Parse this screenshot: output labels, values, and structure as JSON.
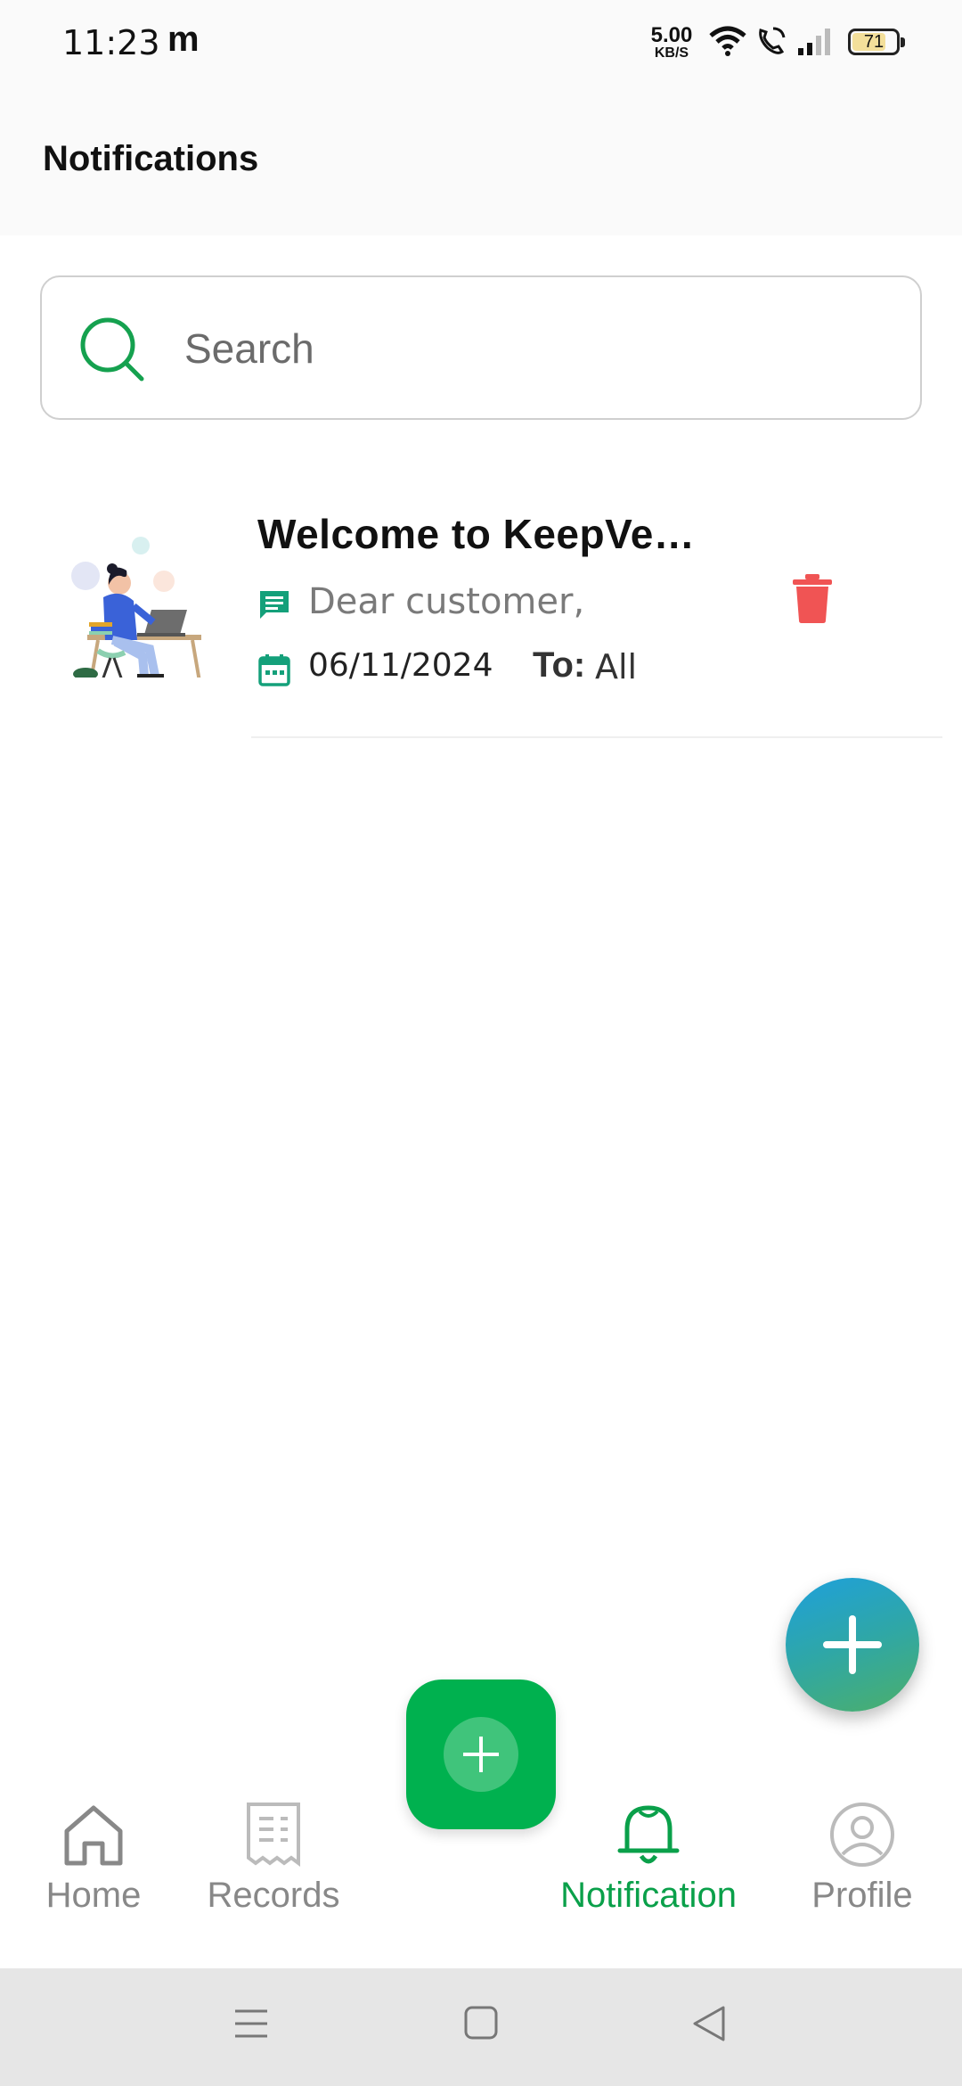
{
  "status_bar": {
    "time": "11:23",
    "carrier_glyph": "m",
    "net_speed_value": "5.00",
    "net_speed_unit": "KB/S",
    "battery_level": "71",
    "icons": [
      "wifi-icon",
      "wifi-calling-icon",
      "signal-icon",
      "battery-icon"
    ]
  },
  "header": {
    "title": "Notifications"
  },
  "search": {
    "placeholder": "Search",
    "icon": "search-icon"
  },
  "notifications": [
    {
      "title": "Welcome to KeepVe…",
      "message": "Dear customer,",
      "date": "06/11/2024",
      "to_label": "To:",
      "to_value": "All",
      "image": "person-at-laptop-illustration",
      "delete_icon": "trash-icon"
    }
  ],
  "bottom_nav": {
    "items": [
      {
        "label": "Home",
        "icon": "home-icon",
        "active": false
      },
      {
        "label": "Records",
        "icon": "receipt-icon",
        "active": false
      },
      {
        "label": "Notification",
        "icon": "bell-icon",
        "active": true
      },
      {
        "label": "Profile",
        "icon": "user-circle-icon",
        "active": false
      }
    ],
    "center_button_icon": "plus-icon"
  },
  "fab": {
    "icon": "plus-icon"
  },
  "system_nav": {
    "icons": [
      "menu-icon",
      "home-square-icon",
      "back-triangle-icon"
    ]
  },
  "colors": {
    "accent_green": "#0aa04a",
    "center_button": "#00b14f",
    "delete_red": "#f05454",
    "teal_icon": "#14a07a",
    "fab_gradient_start": "#1ea0dc",
    "fab_gradient_end": "#4caf6a"
  }
}
